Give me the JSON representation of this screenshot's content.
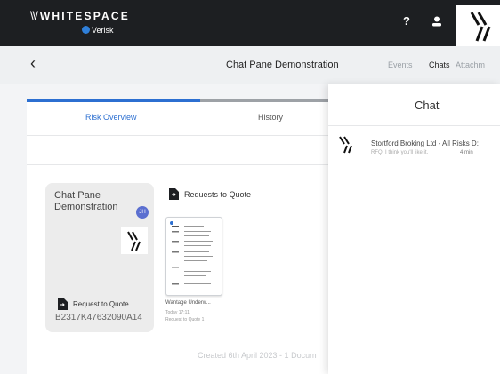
{
  "header": {
    "brand": "WHITESPACE",
    "sub_brand": "Verisk",
    "help": "?",
    "user_icon": "user-icon"
  },
  "subbar": {
    "back": "‹",
    "title": "Chat Pane Demonstration",
    "nav": [
      {
        "label": "Events",
        "color": "#9aa0a6"
      },
      {
        "label": "Chats",
        "color": "#222222"
      },
      {
        "label": "Attachm",
        "color": "#9aa0a6"
      }
    ]
  },
  "tabs": [
    {
      "label": "Risk Overview",
      "active": true
    },
    {
      "label": "History",
      "active": false
    }
  ],
  "tile": {
    "title": "Chat Pane Demonstration",
    "avatar": "JH",
    "req_label": "Request to Quote",
    "reference": "B2317K47632090A14"
  },
  "requests": {
    "heading": "Requests to Quote",
    "doc_name": "Wantage Underw...",
    "doc_time": "Today 17:11",
    "doc_sub": "Request to Quote 1"
  },
  "created": "Created 6th April 2023 - 1 Docum",
  "chat": {
    "title": "Chat",
    "conversation": {
      "title": "Stortford Broking Ltd - All Risks D:",
      "message": "RFQ. I think you'll like it.",
      "time": "4 min"
    }
  },
  "colors": {
    "accent": "#2c6fd1",
    "topbar": "#1d1f22"
  }
}
